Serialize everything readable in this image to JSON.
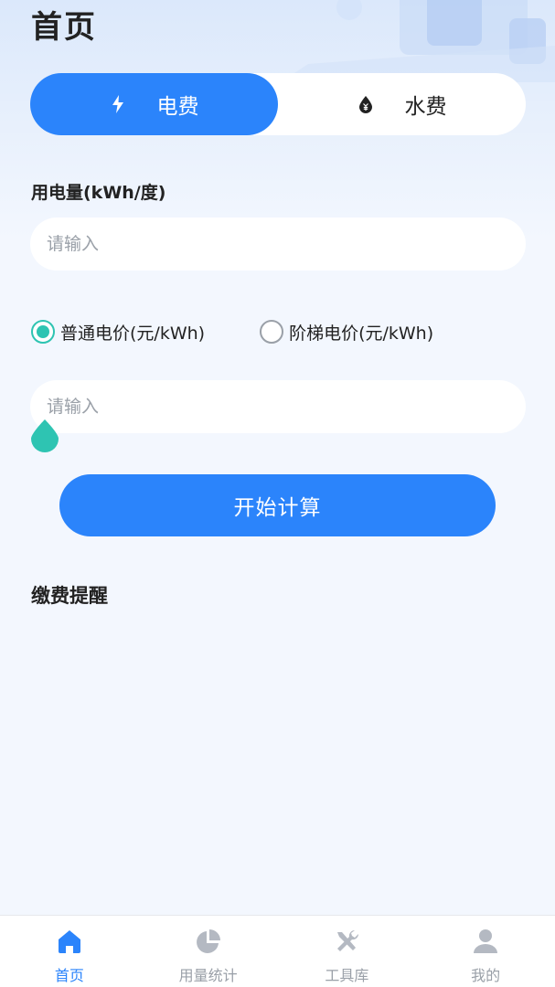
{
  "page": {
    "title": "首页"
  },
  "tabs": [
    {
      "label": "电费",
      "icon": "lightning-icon",
      "active": true
    },
    {
      "label": "水费",
      "icon": "water-drop-yen-icon",
      "active": false
    }
  ],
  "electric": {
    "usage_label": "用电量(kWh/度)",
    "usage_placeholder": "请输入",
    "price_options": [
      {
        "label": "普通电价(元/kWh)",
        "selected": true
      },
      {
        "label": "阶梯电价(元/kWh)",
        "selected": false
      }
    ],
    "price_placeholder": "请输入",
    "calc_button": "开始计算"
  },
  "reminder": {
    "title": "缴费提醒"
  },
  "nav": [
    {
      "label": "首页",
      "icon": "home-icon",
      "active": true
    },
    {
      "label": "用量统计",
      "icon": "pie-chart-icon",
      "active": false
    },
    {
      "label": "工具库",
      "icon": "tools-icon",
      "active": false
    },
    {
      "label": "我的",
      "icon": "user-icon",
      "active": false
    }
  ],
  "colors": {
    "primary": "#2b84fb",
    "radio_checked": "#2ec4b2",
    "background": "#f3f7fe",
    "nav_inactive": "#9aa0a8"
  }
}
